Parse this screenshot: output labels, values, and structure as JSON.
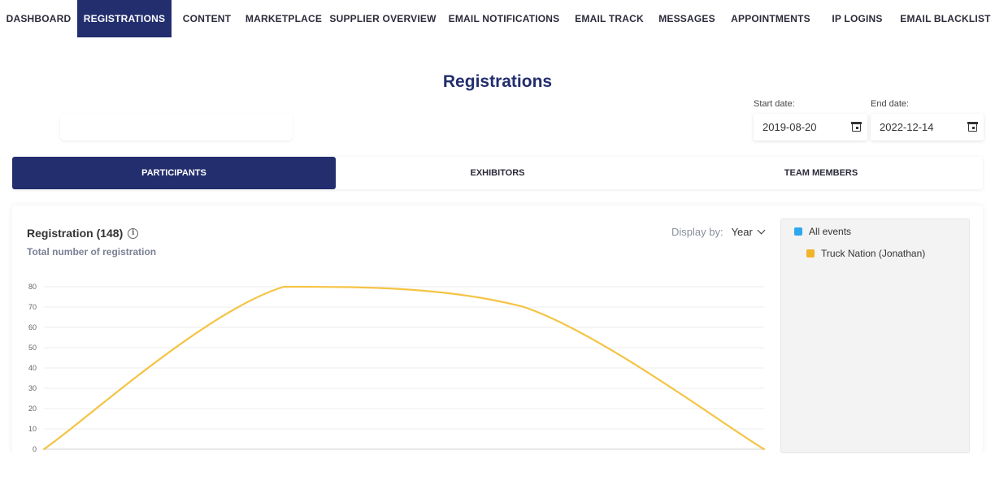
{
  "nav": {
    "items": [
      {
        "label": "DASHBOARD",
        "active": false
      },
      {
        "label": "REGISTRATIONS",
        "active": true
      },
      {
        "label": "CONTENT",
        "active": false
      },
      {
        "label": "MARKETPLACE",
        "active": false
      },
      {
        "label": "SUPPLIER OVERVIEW",
        "active": false
      },
      {
        "label": "EMAIL NOTIFICATIONS",
        "active": false
      },
      {
        "label": "EMAIL TRACK",
        "active": false
      },
      {
        "label": "MESSAGES",
        "active": false
      },
      {
        "label": "APPOINTMENTS",
        "active": false
      },
      {
        "label": "IP LOGINS",
        "active": false
      },
      {
        "label": "EMAIL BLACKLIST",
        "active": false
      }
    ]
  },
  "page": {
    "title": "Registrations"
  },
  "filters": {
    "start_label": "Start date:",
    "start_value": "2019-08-20",
    "end_label": "End date:",
    "end_value": "2022-12-14",
    "calendar_icon": "calendar-icon"
  },
  "tabs": [
    {
      "label": "PARTICIPANTS",
      "active": true
    },
    {
      "label": "EXHIBITORS",
      "active": false
    },
    {
      "label": "TEAM MEMBERS",
      "active": false
    }
  ],
  "card": {
    "title": "Registration (148)",
    "info_icon": "info-icon",
    "subtitle": "Total number of registration",
    "display_by_label": "Display by:",
    "display_by_value": "Year"
  },
  "legend": [
    {
      "label": "All events",
      "color": "#2ea7ef"
    },
    {
      "label": "Truck Nation (Jonathan)",
      "color": "#f0b429"
    }
  ],
  "colors": {
    "accent": "#232e6e",
    "line": "#f5c444"
  },
  "chart_data": {
    "type": "line",
    "x": [
      0,
      1,
      2,
      3
    ],
    "series": [
      {
        "name": "Truck Nation (Jonathan)",
        "values": [
          0,
          80,
          70,
          0
        ],
        "color": "#f5c444"
      }
    ],
    "y_ticks": [
      0,
      10,
      20,
      30,
      40,
      50,
      60,
      70,
      80
    ],
    "ylim": [
      0,
      80
    ],
    "grid": true,
    "xlabel": "",
    "ylabel": ""
  }
}
